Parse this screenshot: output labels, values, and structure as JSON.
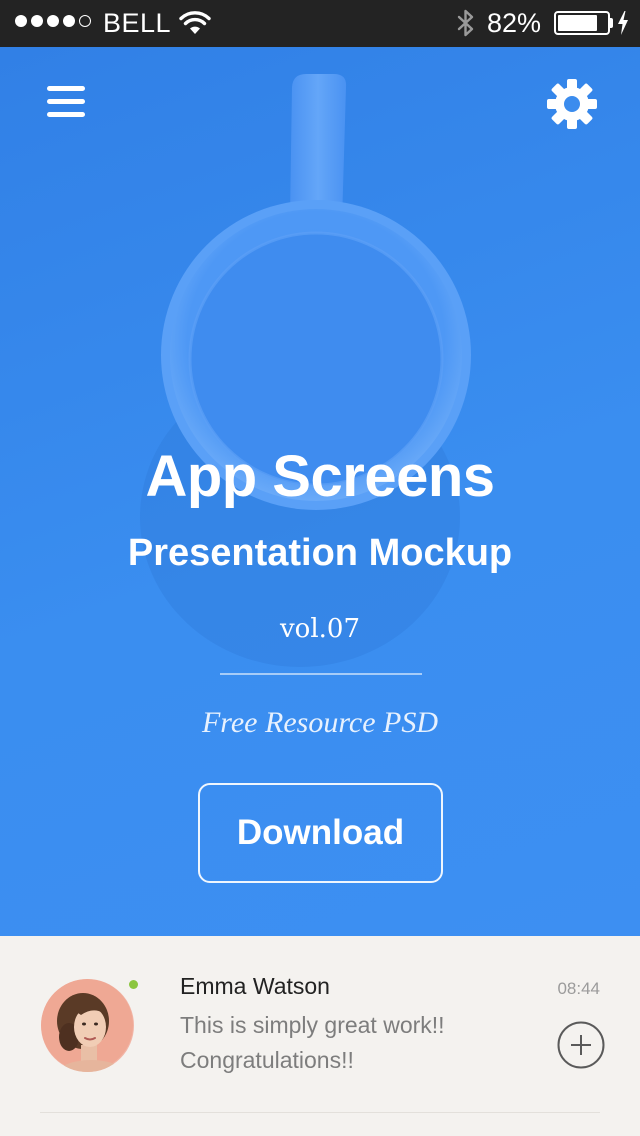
{
  "status_bar": {
    "carrier": "BELL",
    "battery_percent": "82%",
    "battery_level": 0.82,
    "signal_bars_filled": 4,
    "signal_bars_total": 5,
    "icons": [
      "wifi-icon",
      "bluetooth-icon",
      "battery-icon",
      "charging-icon"
    ]
  },
  "header": {
    "menu_icon": "hamburger-menu-icon",
    "settings_icon": "gear-icon"
  },
  "hero": {
    "title": "App Screens",
    "subtitle": "Presentation Mockup",
    "version": "vol.07",
    "tagline": "Free Resource PSD",
    "download_label": "Download",
    "background_color": "#3a8ef0"
  },
  "message": {
    "sender": "Emma Watson",
    "time": "08:44",
    "text": "This is simply great work!! Congratulations!!",
    "online": true,
    "online_color": "#8cc63f",
    "action_icon": "add-circle-icon"
  }
}
